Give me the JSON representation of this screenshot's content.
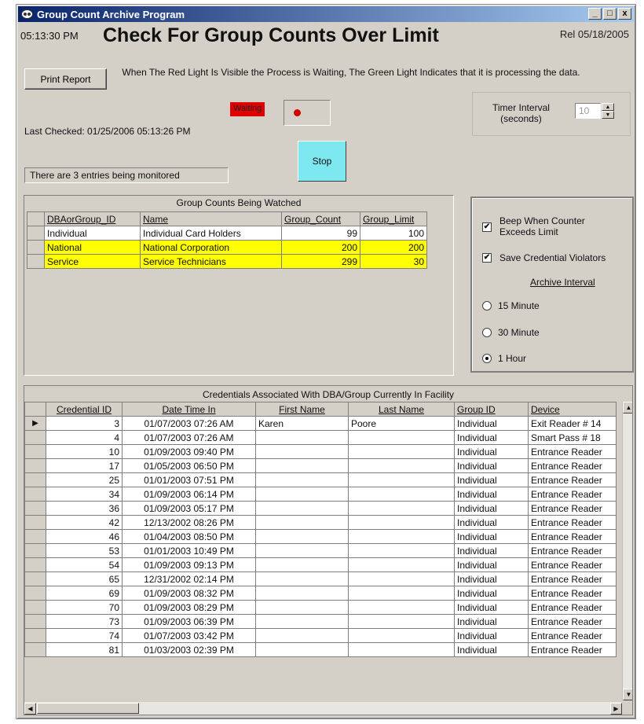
{
  "window": {
    "title": "Group Count Archive Program",
    "controls": {
      "minimize": "_",
      "maximize": "□",
      "close": "x"
    }
  },
  "header": {
    "time": "05:13:30 PM",
    "heading": "Check For Group Counts Over Limit",
    "release": "Rel 05/18/2005"
  },
  "toolbar": {
    "print_label": "Print Report",
    "info_text": "When The Red Light Is Visible the Process is Waiting, The Green Light Indicates that it is processing the data."
  },
  "status": {
    "waiting_label": "Waiting",
    "light_color": "#d00000",
    "last_checked": "Last Checked: 01/25/2006 05:13:26 PM",
    "stop_label": "Stop",
    "monitored_text": "There are 3 entries being monitored"
  },
  "timer": {
    "label_line1": "Timer Interval",
    "label_line2": "(seconds)",
    "value": "10"
  },
  "group_counts": {
    "title": "Group Counts Being Watched",
    "columns": [
      "DBAorGroup_ID",
      "Name",
      "Group_Count",
      "Group_Limit"
    ],
    "rows": [
      {
        "id": "Individual",
        "name": "Individual Card Holders",
        "count": "99",
        "limit": "100",
        "over": false
      },
      {
        "id": "National",
        "name": "National Corporation",
        "count": "200",
        "limit": "200",
        "over": true
      },
      {
        "id": "Service",
        "name": "Service Technicians",
        "count": "299",
        "limit": "30",
        "over": true
      }
    ],
    "highlight_color": "#ffff00"
  },
  "options": {
    "beep_line1": "Beep When Counter",
    "beep_line2": "Exceeds Limit",
    "beep_checked": true,
    "save_label": "Save Credential Violators",
    "save_checked": true,
    "archive_title": "Archive Interval",
    "radios": [
      {
        "label": "15 Minute",
        "selected": false
      },
      {
        "label": "30 Minute",
        "selected": false
      },
      {
        "label": "1 Hour",
        "selected": true
      }
    ]
  },
  "credentials": {
    "title": "Credentials Associated With DBA/Group Currently In Facility",
    "columns": [
      "Credential ID",
      "Date Time In",
      "First Name",
      "Last Name",
      "Group ID",
      "Device"
    ],
    "rows": [
      [
        "3",
        "01/07/2003 07:26 AM",
        "Karen",
        "Poore",
        "Individual",
        "Exit Reader # 14"
      ],
      [
        "4",
        "01/07/2003 07:26 AM",
        "",
        "",
        "Individual",
        "Smart Pass # 18"
      ],
      [
        "10",
        "01/09/2003 09:40 PM",
        "",
        "",
        "Individual",
        "Entrance Reader"
      ],
      [
        "17",
        "01/05/2003 06:50 PM",
        "",
        "",
        "Individual",
        "Entrance Reader"
      ],
      [
        "25",
        "01/01/2003 07:51 PM",
        "",
        "",
        "Individual",
        "Entrance Reader"
      ],
      [
        "34",
        "01/09/2003 06:14 PM",
        "",
        "",
        "Individual",
        "Entrance Reader"
      ],
      [
        "36",
        "01/09/2003 05:17 PM",
        "",
        "",
        "Individual",
        "Entrance Reader"
      ],
      [
        "42",
        "12/13/2002 08:26 PM",
        "",
        "",
        "Individual",
        "Entrance Reader"
      ],
      [
        "46",
        "01/04/2003 08:50 PM",
        "",
        "",
        "Individual",
        "Entrance Reader"
      ],
      [
        "53",
        "01/01/2003 10:49 PM",
        "",
        "",
        "Individual",
        "Entrance Reader"
      ],
      [
        "54",
        "01/09/2003 09:13 PM",
        "",
        "",
        "Individual",
        "Entrance Reader"
      ],
      [
        "65",
        "12/31/2002 02:14 PM",
        "",
        "",
        "Individual",
        "Entrance Reader"
      ],
      [
        "69",
        "01/09/2003 08:32 PM",
        "",
        "",
        "Individual",
        "Entrance Reader"
      ],
      [
        "70",
        "01/09/2003 08:29 PM",
        "",
        "",
        "Individual",
        "Entrance Reader"
      ],
      [
        "73",
        "01/09/2003 06:39 PM",
        "",
        "",
        "Individual",
        "Entrance Reader"
      ],
      [
        "74",
        "01/07/2003 03:42 PM",
        "",
        "",
        "Individual",
        "Entrance Reader"
      ],
      [
        "81",
        "01/03/2003 02:39 PM",
        "",
        "",
        "Individual",
        "Entrance Reader"
      ]
    ],
    "current_row_marker": "▶"
  },
  "icons": {
    "app": "program-icon",
    "scroll_up": "scroll-up-icon",
    "scroll_down": "scroll-down-icon",
    "scroll_left": "scroll-left-icon",
    "scroll_right": "scroll-right-icon"
  }
}
